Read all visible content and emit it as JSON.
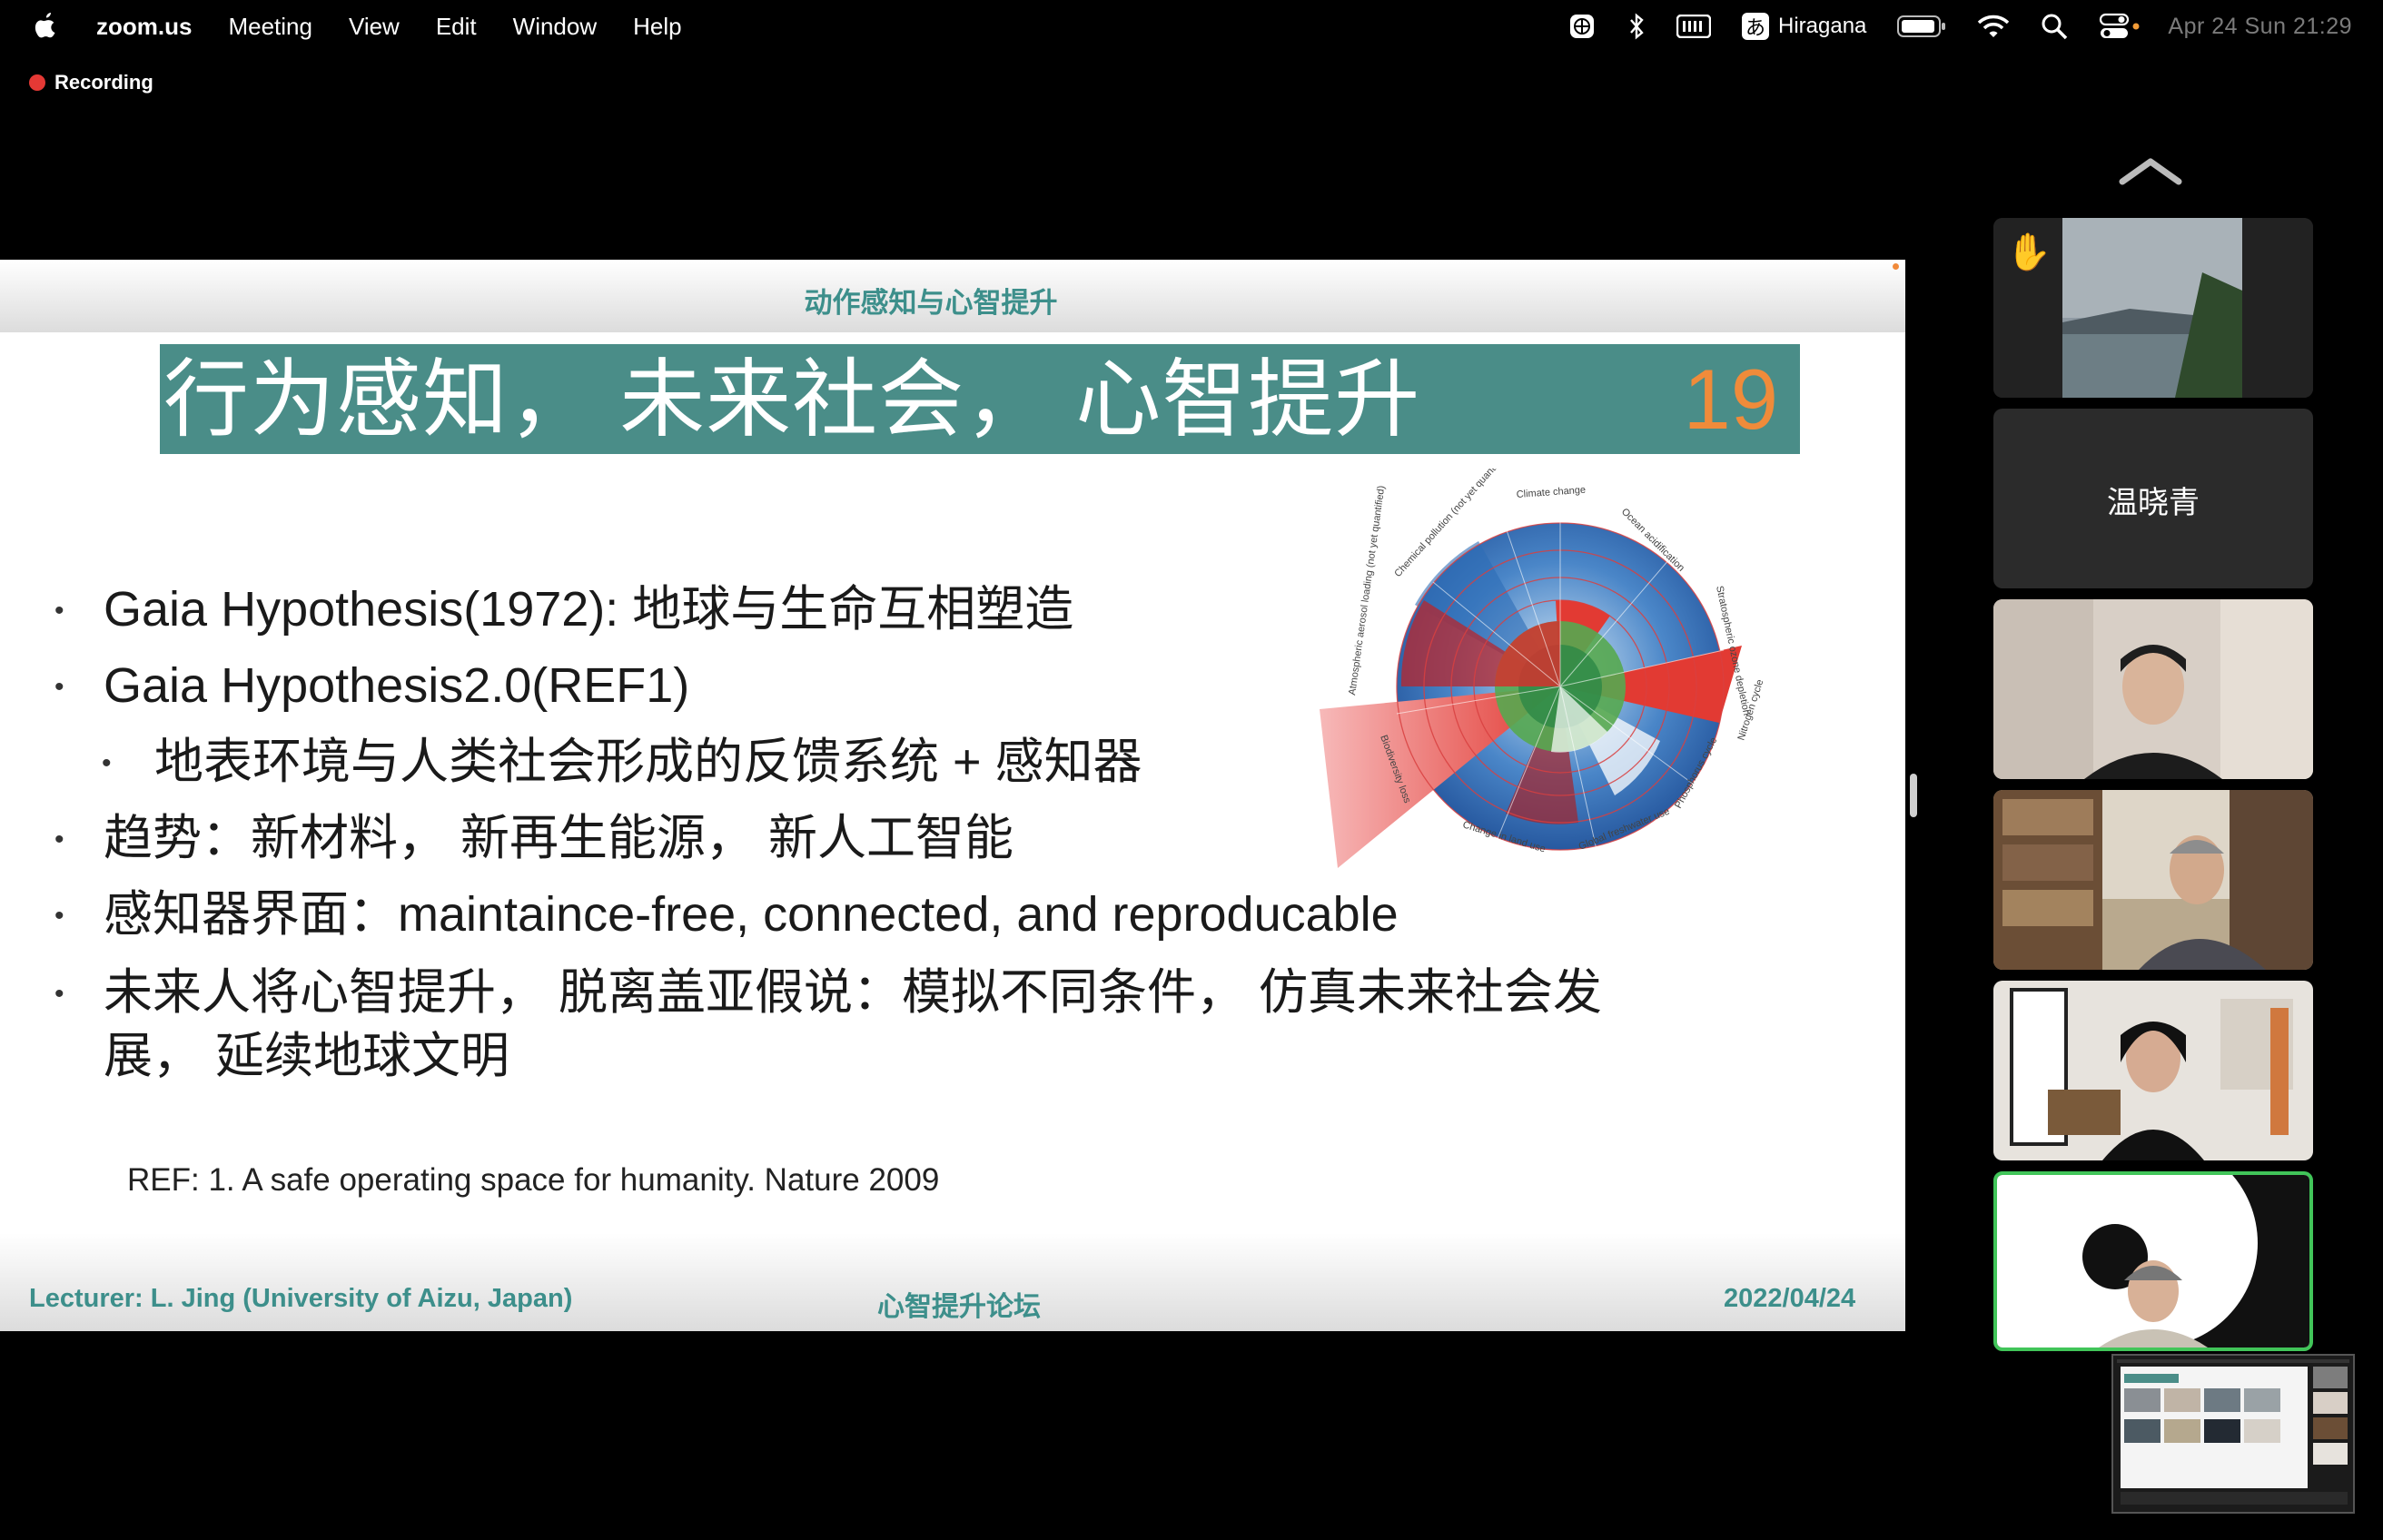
{
  "menubar": {
    "apple_icon": "apple-logo",
    "app_name": "zoom.us",
    "menus": [
      "Meeting",
      "View",
      "Edit",
      "Window",
      "Help"
    ],
    "status_icons": [
      "globe-grid-icon",
      "bluetooth-icon",
      "keyboard-icon"
    ],
    "ime_glyph": "あ",
    "ime_label": "Hiragana",
    "status_icons_right": [
      "battery-icon",
      "wifi-icon",
      "search-icon",
      "control-center-icon"
    ],
    "clock": "Apr 24 Sun  21:29"
  },
  "recording": {
    "label": "Recording",
    "color": "#e53935"
  },
  "slide": {
    "header_title": "动作感知与心智提升",
    "title": "行为感知，  未来社会，  心智提升",
    "page_number": "19",
    "title_bg": "#4a8d88",
    "accent": "#f08b3a",
    "bullets": [
      "Gaia Hypothesis(1972): 地球与生命互相塑造",
      "Gaia Hypothesis2.0(REF1)",
      "地表环境与人类社会形成的反馈系统 + 感知器",
      "趋势：新材料，  新再生能源，  新人工智能",
      "感知器界面：maintaince-free, connected, and reproducable",
      "未来人将心智提升，  脱离盖亚假说：模拟不同条件，  仿真未来社会发",
      "展，  延续地球文明"
    ],
    "reference": "REF: 1. A safe operating space for humanity. Nature 2009",
    "footer": {
      "left": "Lecturer: L. Jing (University of Aizu, Japan)",
      "center": "心智提升论坛",
      "right": "2022/04/24"
    },
    "diagram_labels": {
      "climate": "Climate change",
      "ocean": "Ocean acidification",
      "ozone": "Stratospheric ozone depletion",
      "chemical": "Chemical pollution (not yet quantified)",
      "aerosol": "Atmospheric aerosol loading (not yet quantified)",
      "land": "Change in land use",
      "freshwater": "Global freshwater use",
      "phosphorus": "Phosphorus cycle",
      "biodiversity": "Biodiversity loss",
      "nitrogen": "Nitrogen cycle"
    }
  },
  "gallery": {
    "participant_name": "温晓青",
    "raised_hand_icon": "raised-hand-icon",
    "selected_color": "#41c559"
  }
}
